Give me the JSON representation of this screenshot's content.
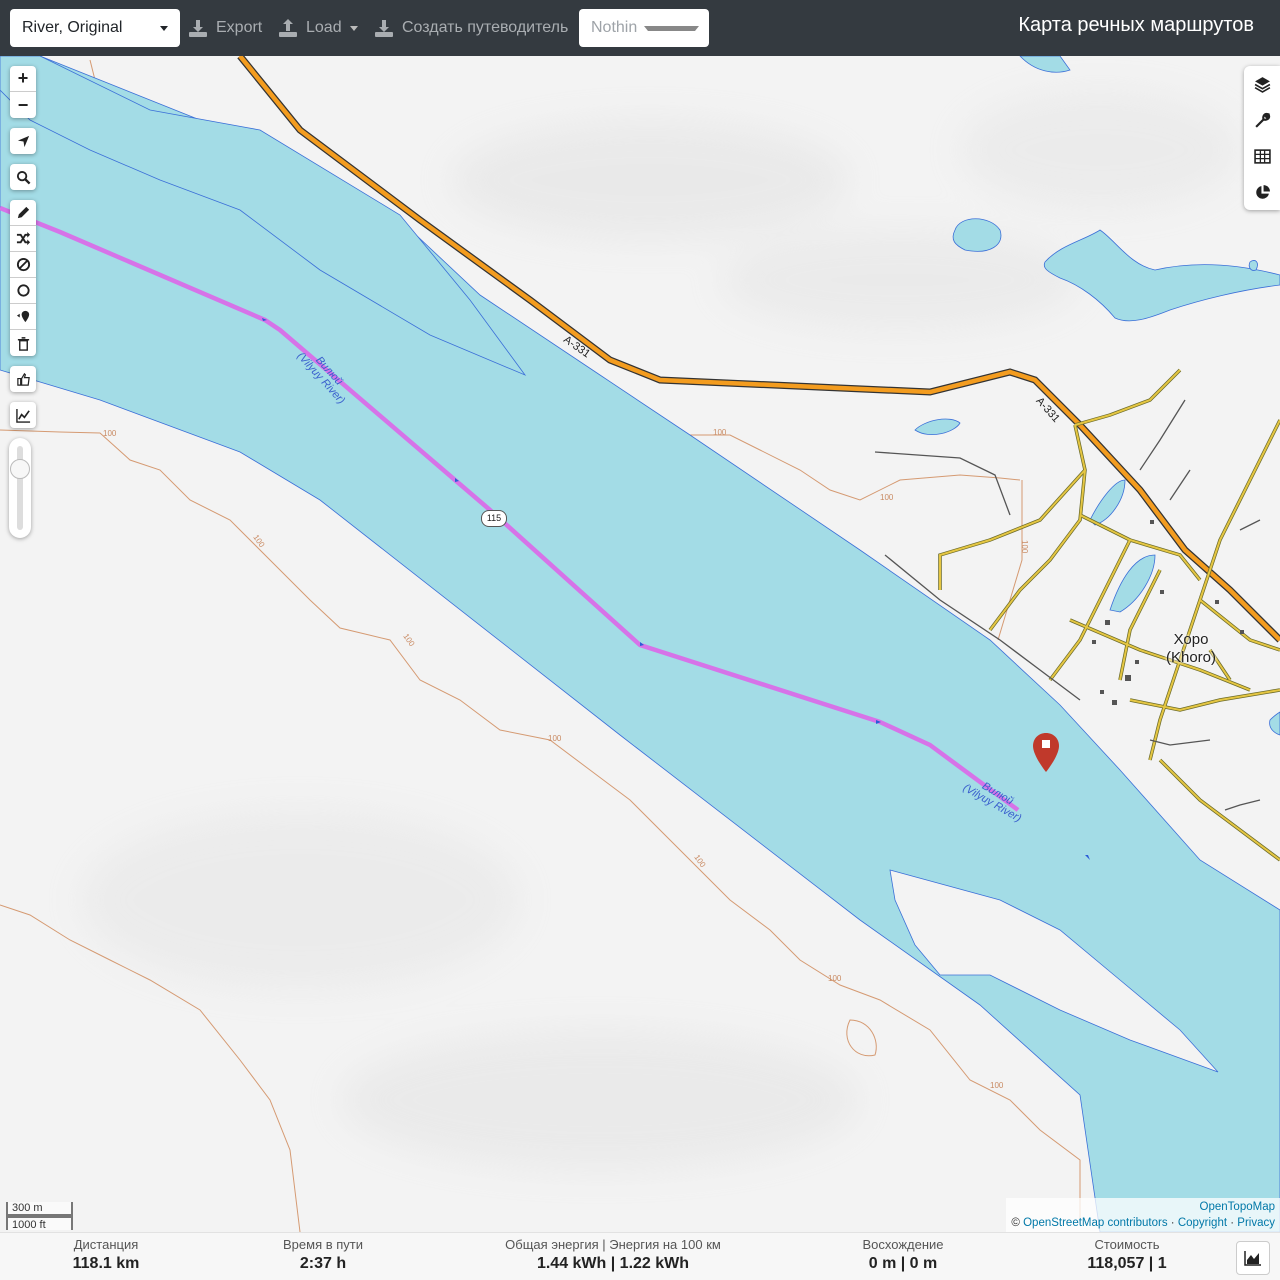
{
  "toolbar": {
    "profile_value": "River, Original",
    "export_label": "Export",
    "load_label": "Load",
    "guide_label": "Создать путеводитель",
    "selection_value": "Nothing selected",
    "app_title": "Карта речных маршрутов"
  },
  "map_controls": {
    "zoom_in": "+",
    "zoom_out": "−",
    "icons": [
      "locate-icon",
      "search-icon",
      "pencil-icon",
      "shuffle-icon",
      "ban-icon",
      "circle-icon",
      "poi-icon",
      "trash-icon",
      "thumbs-up-icon",
      "elevation-chart-icon"
    ],
    "right_icons": [
      "layers-icon",
      "wrench-icon",
      "table-icon",
      "pie-chart-icon"
    ],
    "zoom_slider_level": 0.25
  },
  "map": {
    "river_label_1": "Вилюй (Vilyuy River)",
    "river_label_2": "Вилюй (Vilyuy River)",
    "river_label_1_line1": "Вилюй",
    "river_label_1_line2": "(Vilyuy River)",
    "river_label_2_line1": "Вилюй",
    "river_label_2_line2": "(Vilyuy River)",
    "road_label_1": "A-331",
    "road_label_2": "A-331",
    "route_shield": "115",
    "town_name": "Хоро",
    "town_name_latin": "(Khoro)",
    "contour_labels": [
      "100",
      "100",
      "100",
      "100",
      "100",
      "100",
      "100",
      "100",
      "100",
      "100"
    ]
  },
  "scale": {
    "metric": "300 m",
    "imperial": "1000 ft"
  },
  "attribution": {
    "opentopomap": "OpenTopoMap",
    "prefix": "©",
    "osm": "OpenStreetMap contributors",
    "sep1": "·",
    "copyright": "Copyright",
    "sep2": "·",
    "privacy": "Privacy"
  },
  "stats": {
    "distance_label": "Дистанция",
    "distance_value": "118.1 km",
    "time_label": "Время в пути",
    "time_value": "2:37 h",
    "energy_label": "Общая энергия | Энергия на 100 км",
    "energy_value": "1.44 kWh | 1.22 kWh",
    "ascent_label": "Восхождение",
    "ascent_value": "0 m | 0 m",
    "cost_label": "Стоимость",
    "cost_value": "118,057 | 1"
  },
  "colors": {
    "topbar": "#343a40",
    "water": "#a3dce6",
    "route": "#e07ef0",
    "road_major": "#f39c1f",
    "road_minor": "#e5c642",
    "contour": "#d59a72",
    "marker": "#c0392b"
  }
}
